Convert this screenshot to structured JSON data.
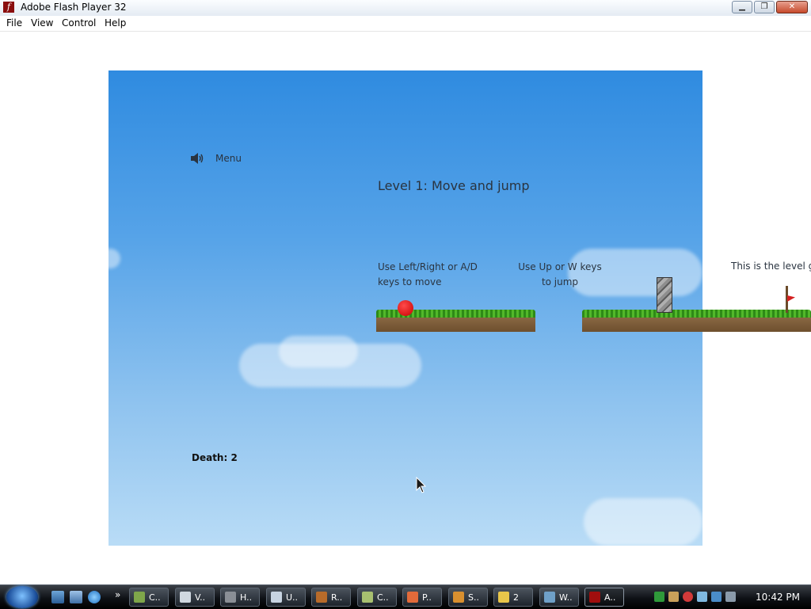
{
  "window": {
    "title": "Adobe Flash Player 32",
    "icon": "flash-icon",
    "buttons": {
      "minimize": "minimize-icon",
      "maximize": "restore-icon",
      "close": "close-icon"
    }
  },
  "menubar": {
    "items": [
      "File",
      "View",
      "Control",
      "Help"
    ]
  },
  "game": {
    "menu_label": "Menu",
    "speaker_icon": "speaker-icon",
    "level_title": "Level 1: Move and jump",
    "instruction_move": [
      "Use Left/Right or A/D",
      "keys to move"
    ],
    "instruction_jump": [
      "Use Up or W keys",
      "to jump"
    ],
    "instruction_goal": "This is the level g",
    "death_label": "Death: 2"
  },
  "taskbar": {
    "start_icon": "windows-start-icon",
    "quicklaunch": [
      "show-desktop-icon",
      "switch-windows-icon",
      "internet-explorer-icon"
    ],
    "quicklaunch_more": "»",
    "tasks": [
      {
        "label": "C..",
        "icon": "app-icon",
        "color": "#7fa64a"
      },
      {
        "label": "V..",
        "icon": "notepad-icon",
        "color": "#d0d8e0"
      },
      {
        "label": "H..",
        "icon": "app-icon",
        "color": "#8a8f96"
      },
      {
        "label": "U..",
        "icon": "notepad-icon",
        "color": "#c8d4e2"
      },
      {
        "label": "R..",
        "icon": "app-icon",
        "color": "#b86b2a"
      },
      {
        "label": "C..",
        "icon": "app-icon",
        "color": "#a8c070"
      },
      {
        "label": "P..",
        "icon": "app-icon",
        "color": "#e26a3a"
      },
      {
        "label": "S..",
        "icon": "app-icon",
        "color": "#d9902f"
      },
      {
        "label": "2",
        "icon": "folder-icon",
        "color": "#e8c64a"
      },
      {
        "label": "W..",
        "icon": "app-icon",
        "color": "#6fa0c8"
      },
      {
        "label": "A..",
        "icon": "flash-icon",
        "color": "#a10e0e"
      }
    ],
    "tray_icons": [
      "network-icon",
      "tool-icon",
      "shield-x-icon",
      "app-icon",
      "monitor-icon",
      "volume-muted-icon"
    ],
    "clock": "10:42 PM"
  }
}
